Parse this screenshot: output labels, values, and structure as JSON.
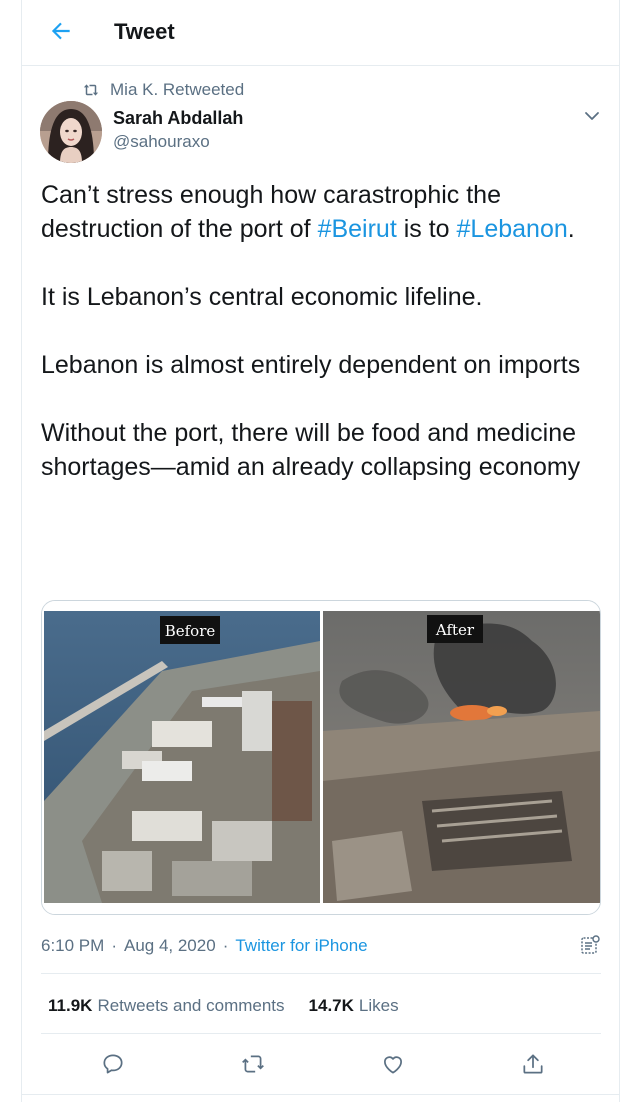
{
  "header": {
    "title": "Tweet",
    "back_icon": "arrow-left-icon"
  },
  "retweet": {
    "label": "Mia K. Retweeted",
    "icon": "retweet-icon"
  },
  "author": {
    "name": "Sarah Abdallah",
    "handle": "@sahouraxo"
  },
  "tweet": {
    "line1_pre": "Can’t stress enough how carastrophic the destruction of the port of ",
    "hashtag1": "#Beirut",
    "line1_mid": " is to ",
    "hashtag2": "#Lebanon",
    "line1_end": ".",
    "para2": "It is Lebanon’s central economic lifeline.",
    "para3": "Lebanon is almost entirely dependent on imports",
    "para4": "Without the port, there will be food and medicine shortages—amid an already collapsing economy"
  },
  "media": {
    "before_label": "Before",
    "after_label": "After"
  },
  "meta": {
    "time": "6:10 PM",
    "separator": "·",
    "date": "Aug 4, 2020",
    "source": "Twitter for iPhone"
  },
  "stats": {
    "retweets_count": "11.9K",
    "retweets_label": "Retweets and comments",
    "likes_count": "14.7K",
    "likes_label": "Likes"
  },
  "colors": {
    "link": "#1b95e0",
    "secondary_text": "#5b7083",
    "border": "#e6ecf0"
  }
}
